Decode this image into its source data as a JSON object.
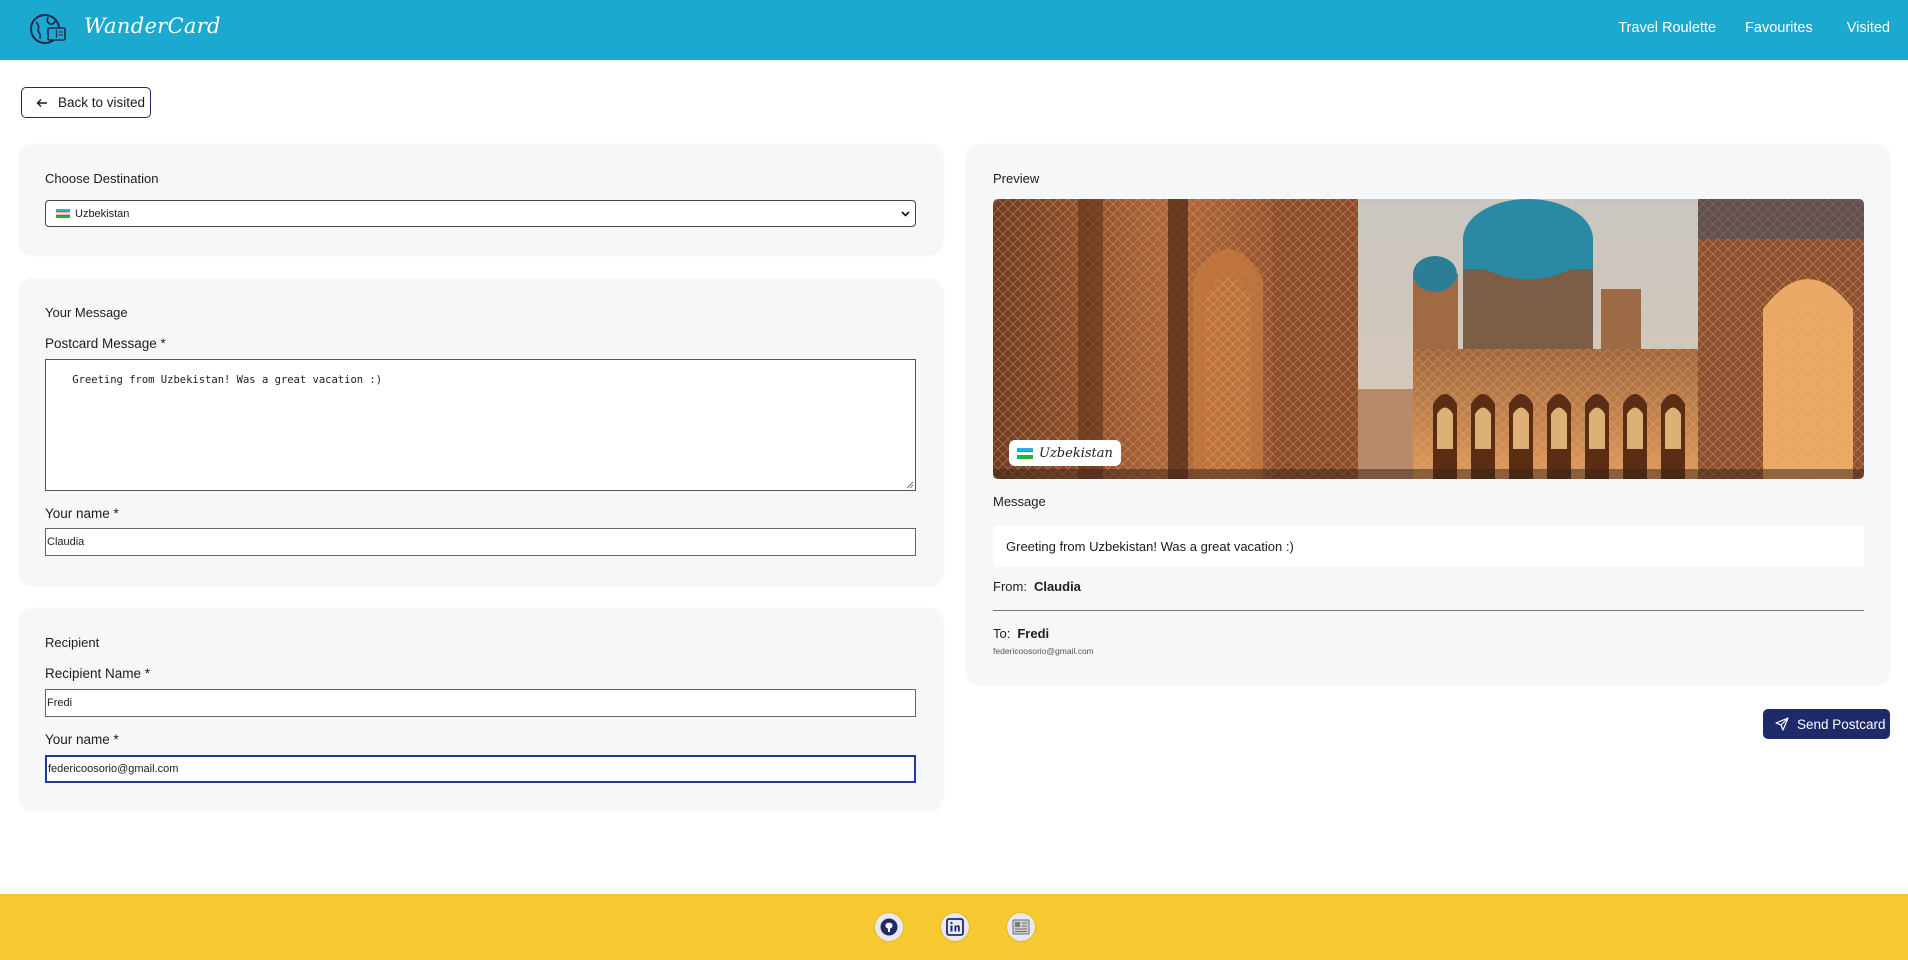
{
  "header": {
    "brand": "WanderCard",
    "nav": [
      "Travel Roulette",
      "Favourites",
      "Visited"
    ]
  },
  "back_button": {
    "label": "Back to visited"
  },
  "destination": {
    "title": "Choose Destination",
    "selected": "Uzbekistan"
  },
  "message_section": {
    "title": "Your Message",
    "message_label": "Postcard Message *",
    "message_value": "Greeting from Uzbekistan! Was a great vacation :)",
    "name_label": "Your name *",
    "name_value": "Claudia"
  },
  "recipient_section": {
    "title": "Recipient",
    "name_label": "Recipient Name *",
    "name_value": "Fredi",
    "email_label": "Your name *",
    "email_value": "federicoosorio@gmail.com"
  },
  "preview": {
    "title": "Preview",
    "country": "Uzbekistan",
    "message_label": "Message",
    "message": "Greeting from Uzbekistan! Was a great vacation :)",
    "from_label": "From:",
    "from_name": "Claudia",
    "to_label": "To:",
    "to_name": "Fredi",
    "to_email": "federicoosorio@gmail.com"
  },
  "send_button": {
    "label": "Send Postcard"
  },
  "footer": {
    "icons": [
      "github-icon",
      "linkedin-icon",
      "portfolio-icon"
    ]
  },
  "colors": {
    "header": "#1ca9d0",
    "footer": "#f6c930",
    "primary": "#1f2a6b",
    "card": "#f6f7f9"
  }
}
